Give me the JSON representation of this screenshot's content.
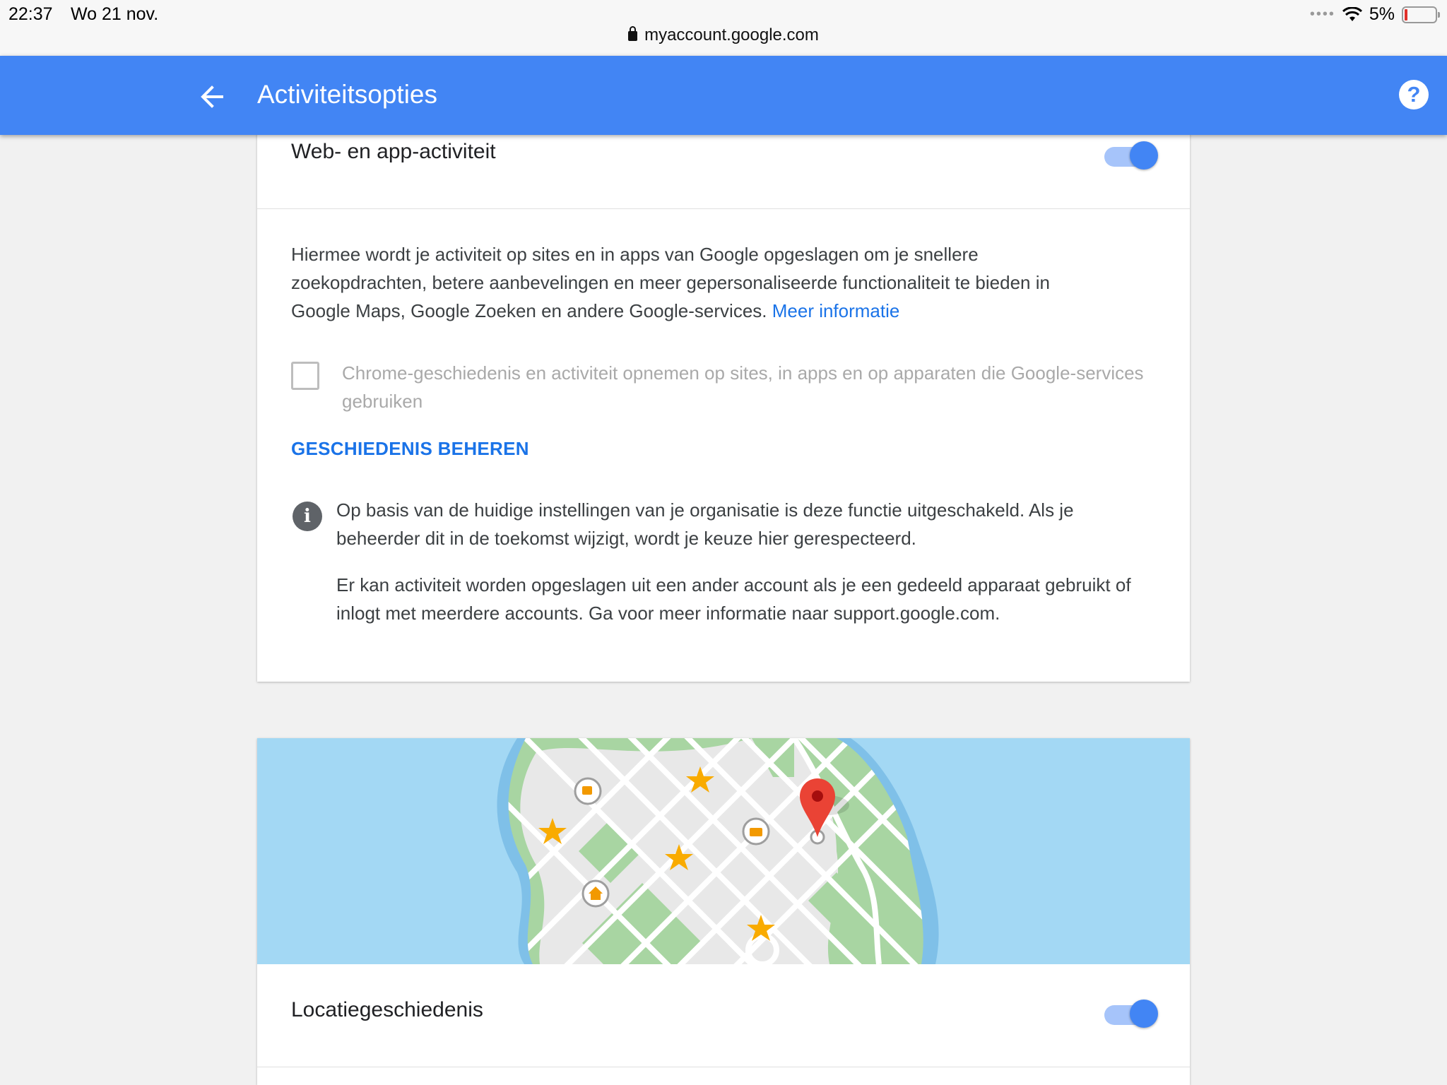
{
  "status_bar": {
    "time": "22:37",
    "date": "Wo 21 nov.",
    "battery": "5%",
    "url": "myaccount.google.com"
  },
  "app_bar": {
    "title": "Activiteitsopties",
    "back_icon": "arrow-left-icon",
    "help_icon": "help-circle-icon",
    "color": "#4285f4"
  },
  "web_app_activity": {
    "title": "Web- en app-activiteit",
    "toggle_on": true,
    "description": "Hiermee wordt je activiteit op sites en in apps van Google opgeslagen om je snellere zoekopdrachten, betere aanbevelingen en meer gepersonaliseerde functionaliteit te bieden in Google Maps, Google Zoeken en andere Google-services.",
    "more_info_link": "Meer informatie",
    "checkbox_label": "Chrome-geschiedenis en activiteit opnemen op sites, in apps en op apparaten die Google-services gebruiken",
    "checkbox_checked": false,
    "manage_link": "GESCHIEDENIS BEHEREN",
    "info_text_1": "Op basis van de huidige instellingen van je organisatie is deze functie uitgeschakeld. Als je beheerder dit in de toekomst wijzigt, wordt je keuze hier gerespecteerd.",
    "info_text_2": "Er kan activiteit worden opgeslagen uit een ander account als je een gedeeld apparaat gebruikt of inlogt met meerdere accounts. Ga voor meer informatie naar support.google.com."
  },
  "location_history": {
    "title": "Locatiegeschiedenis",
    "toggle_on": true,
    "illustration": "map-illustration"
  },
  "colors": {
    "accent": "#4285f4",
    "link": "#1a73e8",
    "water": "#a3d8f4",
    "park": "#a8d5a2",
    "pin": "#ea4335",
    "star": "#f9ab00"
  }
}
